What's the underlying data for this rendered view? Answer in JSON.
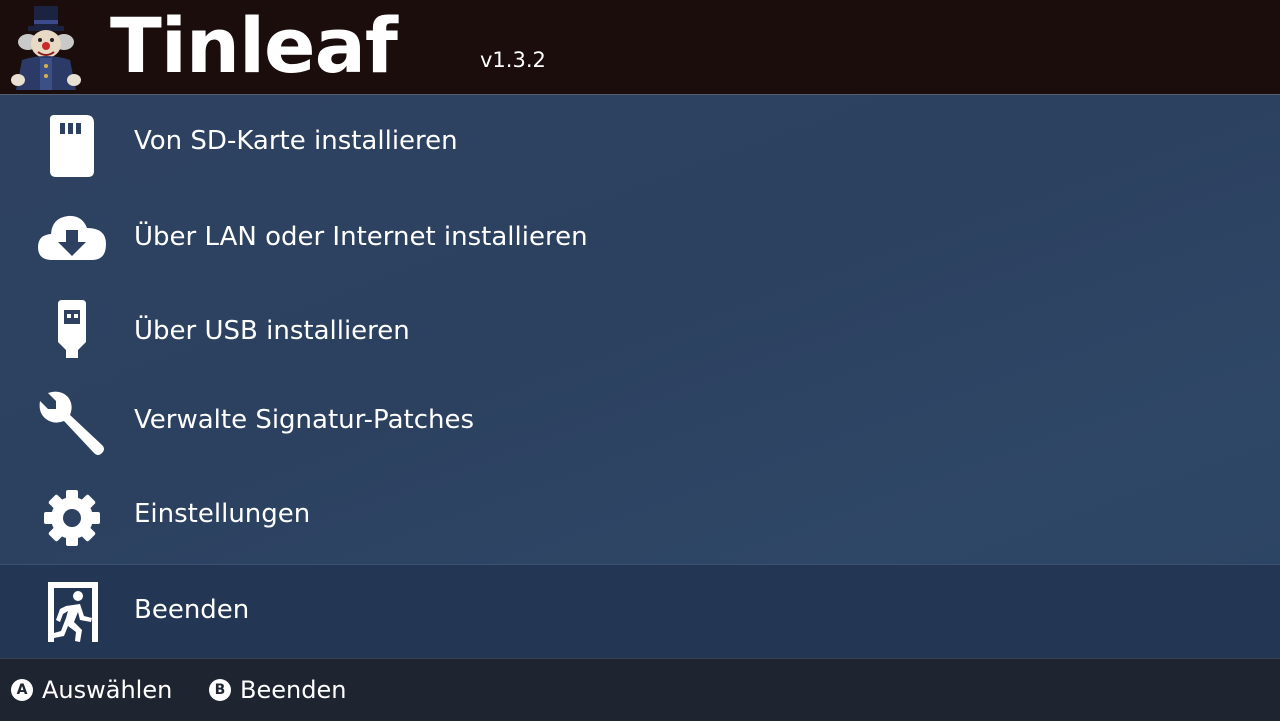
{
  "header": {
    "title": "Tinleaf",
    "version": "v1.3.2",
    "logo_icon": "clown-mascot-icon"
  },
  "menu": {
    "items": [
      {
        "label": "Von SD-Karte installieren",
        "icon": "sd-card-icon"
      },
      {
        "label": "Über LAN oder Internet installieren",
        "icon": "cloud-download-icon"
      },
      {
        "label": "Über USB installieren",
        "icon": "usb-icon"
      },
      {
        "label": "Verwalte Signatur-Patches",
        "icon": "wrench-icon"
      },
      {
        "label": "Einstellungen",
        "icon": "gear-icon"
      },
      {
        "label": "Beenden",
        "icon": "exit-door-icon",
        "selected": true
      }
    ]
  },
  "footer": {
    "hints": [
      {
        "button": "A",
        "label": "Auswählen"
      },
      {
        "button": "B",
        "label": "Beenden"
      }
    ]
  },
  "colors": {
    "header_bg": "#1a0d0c",
    "main_bg": "#2f4260",
    "selected_bg": "#233653",
    "footer_bg": "#1f2530",
    "text": "#ffffff"
  }
}
